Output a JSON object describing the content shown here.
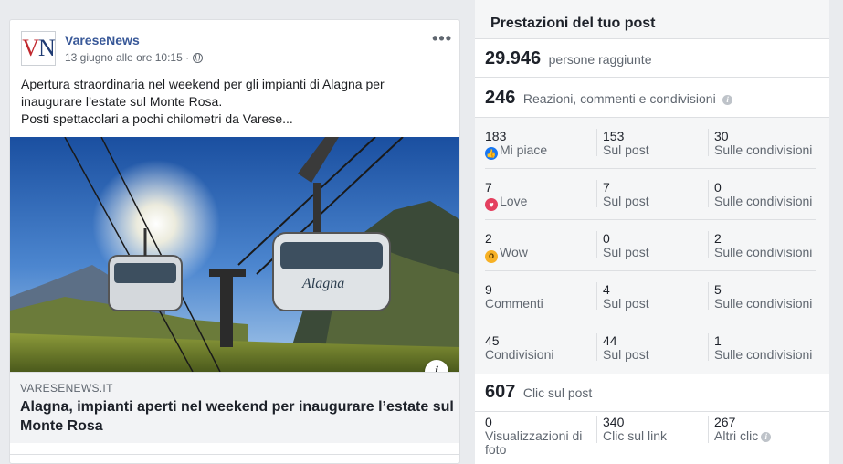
{
  "post": {
    "avatar_text_v": "V",
    "avatar_text_n": "N",
    "page_name": "VareseNews",
    "date": "13 giugno alle ore 10:15 ·",
    "more": "•••",
    "text_line1": "Apertura straordinaria nel weekend per gli impianti di Alagna per",
    "text_line2": "inaugurare l’estate sul Monte Rosa.",
    "text_line3": "Posti spettacolari a pochi chilometri da Varese...",
    "image_text": "Alagna",
    "info_glyph": "i",
    "link_domain": "VARESENEWS.IT",
    "link_title": "Alagna, impianti aperti nel weekend per inaugurare l’estate sul Monte Rosa"
  },
  "panel": {
    "title": "Prestazioni del tuo post",
    "reach_value": "29.946",
    "reach_label": "persone raggiunte",
    "engagement_value": "246",
    "engagement_label": "Reazioni, commenti e condivisioni",
    "rows": [
      {
        "icon": "like-icon",
        "c1_num": "183",
        "c1_lbl": "Mi piace",
        "c2_num": "153",
        "c2_lbl": "Sul post",
        "c3_num": "30",
        "c3_lbl": "Sulle condivisioni"
      },
      {
        "icon": "love-icon",
        "c1_num": "7",
        "c1_lbl": "Love",
        "c2_num": "7",
        "c2_lbl": "Sul post",
        "c3_num": "0",
        "c3_lbl": "Sulle condivisioni"
      },
      {
        "icon": "wow-icon",
        "c1_num": "2",
        "c1_lbl": "Wow",
        "c2_num": "0",
        "c2_lbl": "Sul post",
        "c3_num": "2",
        "c3_lbl": "Sulle condivisioni"
      },
      {
        "c1_num": "9",
        "c1_lbl": "Commenti",
        "c2_num": "4",
        "c2_lbl": "Sul post",
        "c3_num": "5",
        "c3_lbl": "Sulle condivisioni"
      },
      {
        "c1_num": "45",
        "c1_lbl": "Condivisioni",
        "c2_num": "44",
        "c2_lbl": "Sul post",
        "c3_num": "1",
        "c3_lbl": "Sulle condivisioni"
      }
    ],
    "clicks_value": "607",
    "clicks_label": "Clic sul post",
    "clicks": {
      "c1_num": "0",
      "c1_lbl1": "Visualizzazioni di",
      "c1_lbl2": "foto",
      "c2_num": "340",
      "c2_lbl": "Clic sul link",
      "c3_num": "267",
      "c3_lbl": "Altri clic"
    },
    "colors": {
      "like": "#1877f2",
      "love": "#e4405f",
      "wow": "#f7b125",
      "link": "#385898"
    }
  }
}
